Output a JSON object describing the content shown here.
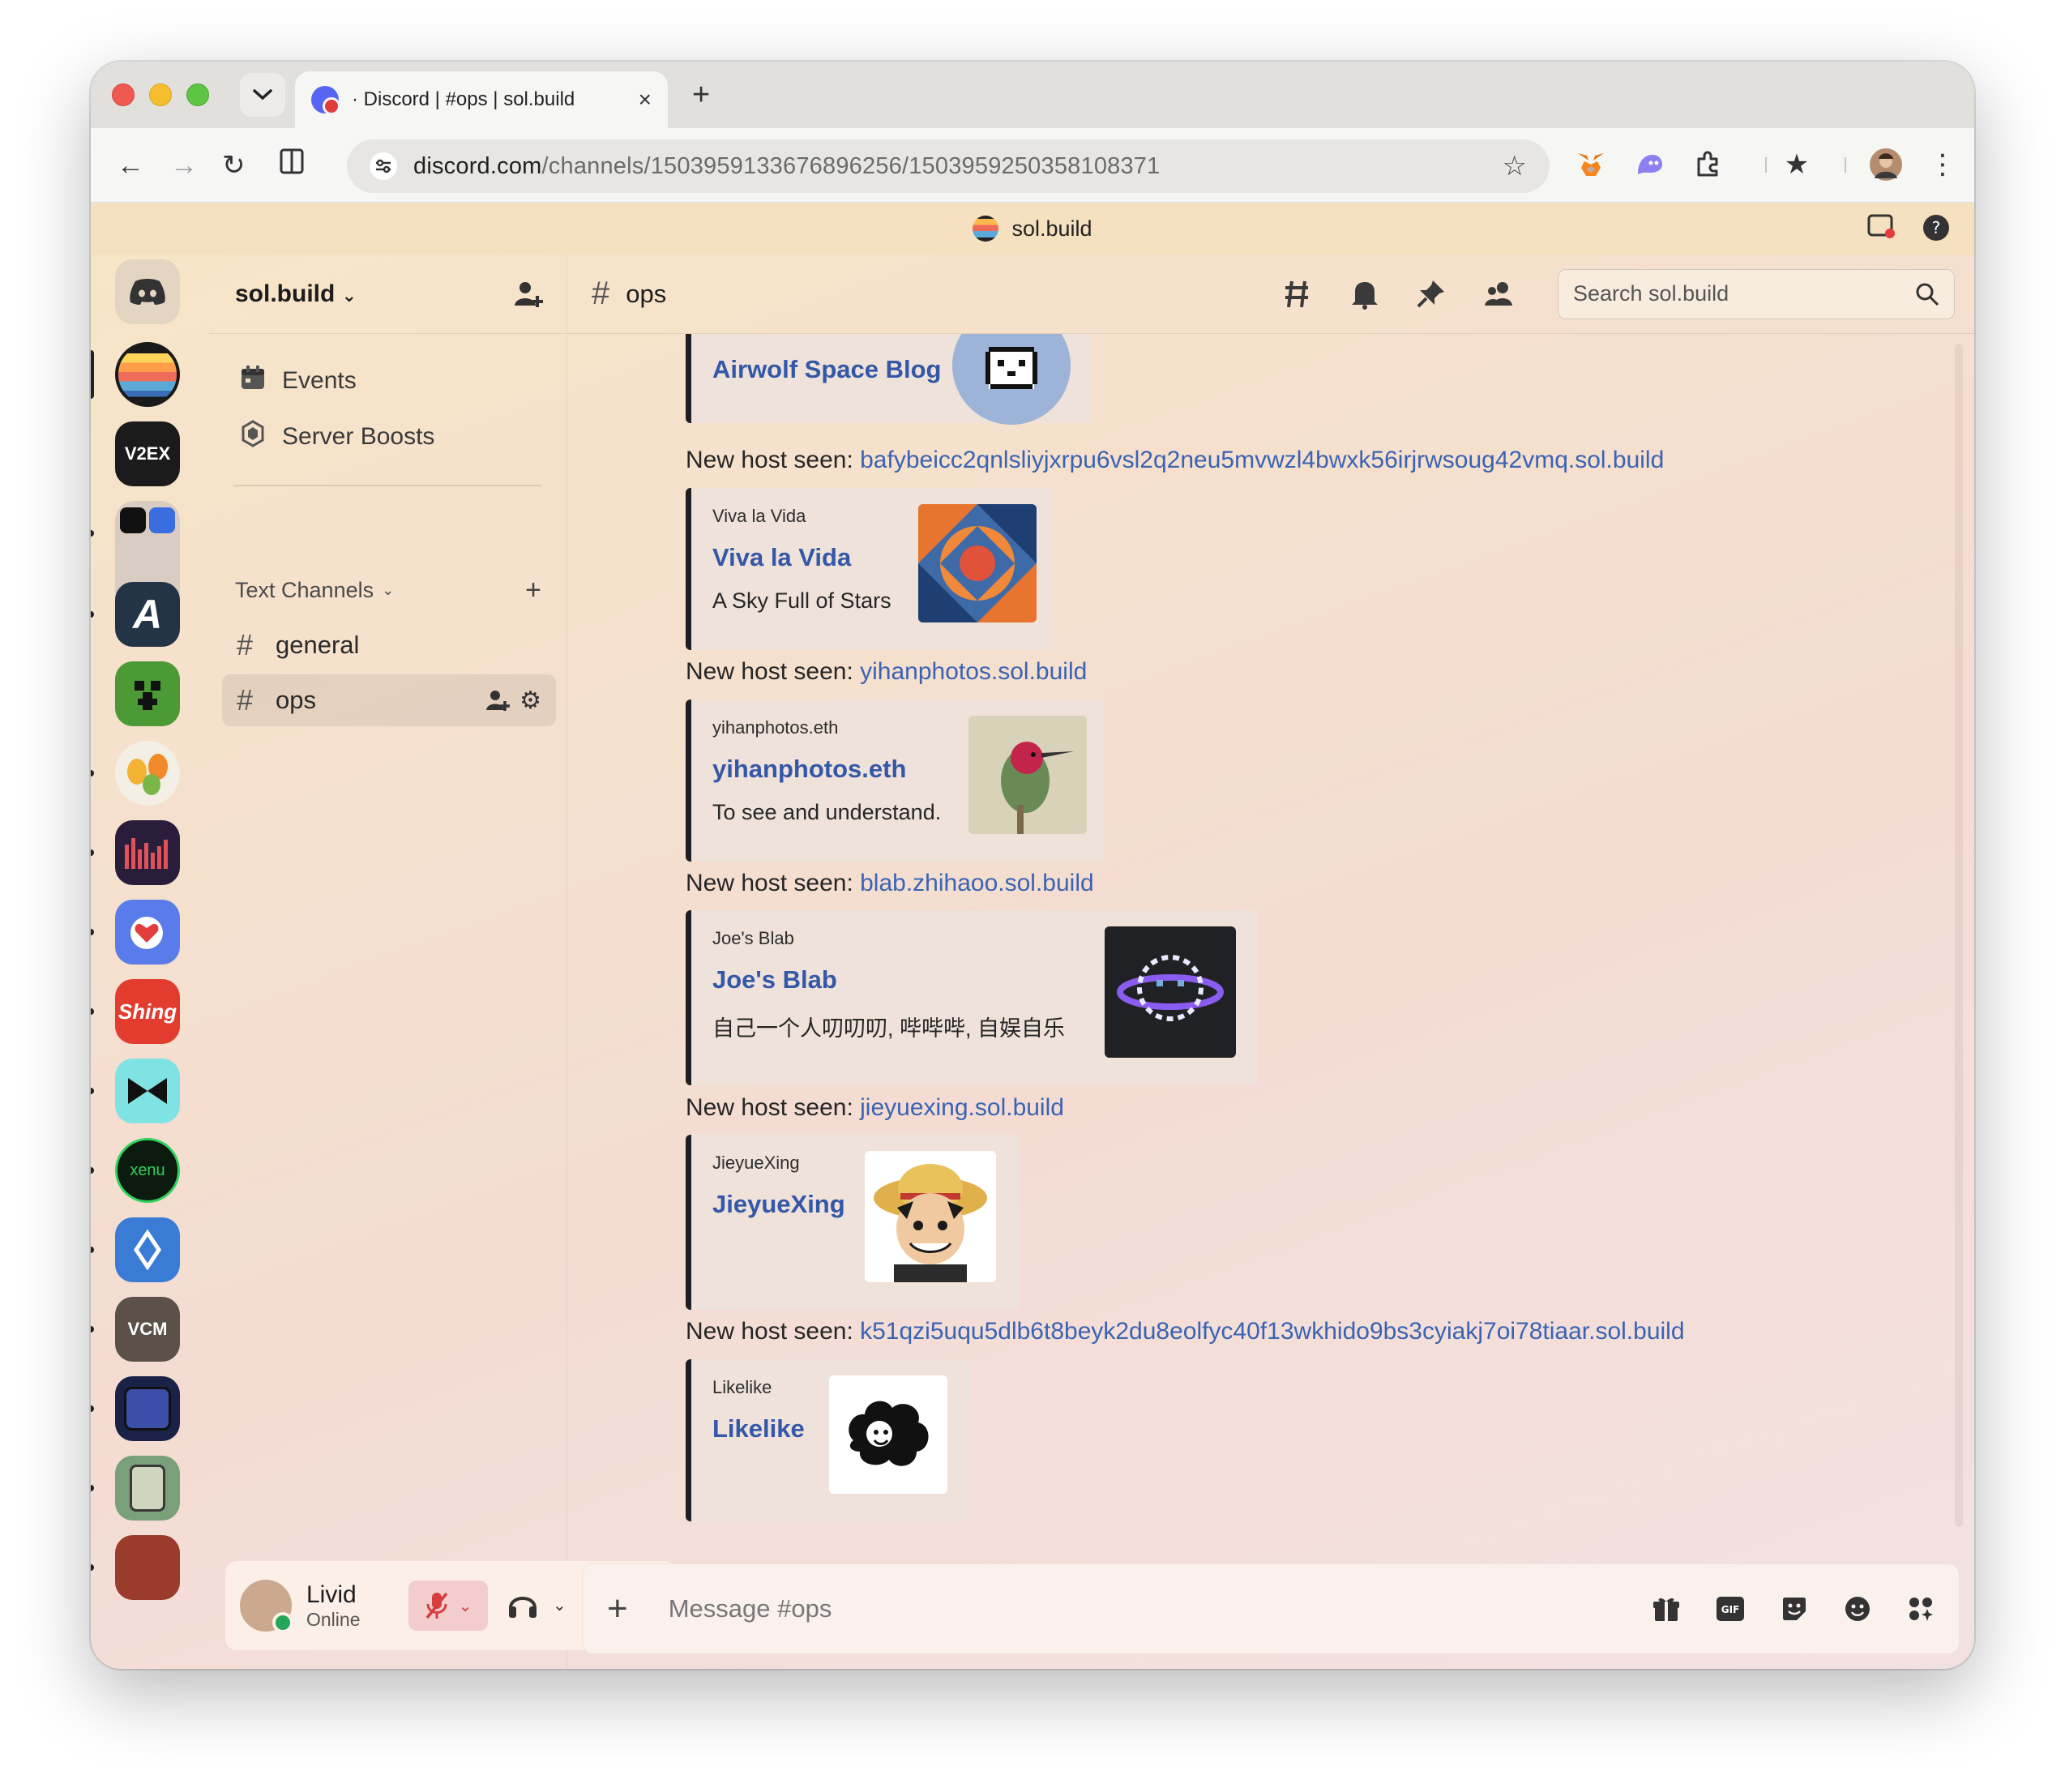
{
  "browser": {
    "tab_title": "· Discord | #ops | sol.build",
    "tab_close": "×",
    "new_tab": "+",
    "url_host": "discord.com",
    "url_path": "/channels/1503959133676896256/1503959250358108371",
    "banner_title": "sol.build"
  },
  "server": {
    "name": "sol.build",
    "nav": [
      {
        "label": "Events",
        "icon": "calendar-icon"
      },
      {
        "label": "Server Boosts",
        "icon": "boost-icon"
      }
    ],
    "category": "Text Channels",
    "channels": [
      {
        "name": "general",
        "selected": false
      },
      {
        "name": "ops",
        "selected": true
      }
    ]
  },
  "server_list": [
    {
      "name": "discord-home",
      "label": "",
      "color": "#e4d4c2"
    },
    {
      "name": "sol-build",
      "label": "",
      "color": "#222222"
    },
    {
      "name": "v2ex",
      "label": "V2EX",
      "color": "#1b1b1b"
    },
    {
      "name": "folder",
      "label": "",
      "color": "#d9cdc3"
    },
    {
      "name": "a-server",
      "label": "A",
      "color": "#243447"
    },
    {
      "name": "minecraft",
      "label": "",
      "color": "#4c9a35"
    },
    {
      "name": "birds",
      "label": "",
      "color": "#f3efe4"
    },
    {
      "name": "music",
      "label": "",
      "color": "#2a1d3c"
    },
    {
      "name": "heart-app",
      "label": "",
      "color": "#5a7bea"
    },
    {
      "name": "shing",
      "label": "Shing",
      "color": "#e23c2f"
    },
    {
      "name": "bowtie",
      "label": "",
      "color": "#7fe3e3"
    },
    {
      "name": "xenu",
      "label": "xenu",
      "color": "#0d1a10"
    },
    {
      "name": "ens",
      "label": "",
      "color": "#3a7bd5"
    },
    {
      "name": "vcm",
      "label": "VCM",
      "color": "#5b5148"
    },
    {
      "name": "ghost",
      "label": "",
      "color": "#1b2247"
    },
    {
      "name": "gameboy",
      "label": "",
      "color": "#7aa07a"
    },
    {
      "name": "skull",
      "label": "",
      "color": "#9a3b2c"
    }
  ],
  "user": {
    "name": "Livid",
    "status": "Online"
  },
  "channel": {
    "name": "ops",
    "search_placeholder": "Search sol.build",
    "composer_placeholder": "Message #ops"
  },
  "messages": [
    {
      "type": "embed",
      "provider": "",
      "title": "Airwolf Space Blog",
      "desc": ""
    },
    {
      "type": "text",
      "prefix": "New host seen: ",
      "link": "bafybeicc2qnlsliyjxrpu6vsl2q2neu5mvwzl4bwxk56irjrwsoug42vmq.sol.build"
    },
    {
      "type": "embed",
      "provider": "Viva la Vida",
      "title": "Viva la Vida",
      "desc": "A Sky Full of Stars"
    },
    {
      "type": "text",
      "prefix": "New host seen: ",
      "link": "yihanphotos.sol.build"
    },
    {
      "type": "embed",
      "provider": "yihanphotos.eth",
      "title": "yihanphotos.eth",
      "desc": "To see and understand."
    },
    {
      "type": "text",
      "prefix": "New host seen: ",
      "link": "blab.zhihaoo.sol.build"
    },
    {
      "type": "embed",
      "provider": "Joe's Blab",
      "title": "Joe's Blab",
      "desc": "自己一个人叨叨叨, 哔哔哔, 自娱自乐"
    },
    {
      "type": "text",
      "prefix": "New host seen: ",
      "link": "jieyuexing.sol.build"
    },
    {
      "type": "embed",
      "provider": "JieyueXing",
      "title": "JieyueXing",
      "desc": ""
    },
    {
      "type": "text",
      "prefix": "New host seen: ",
      "link": "k51qzi5uqu5dlb6t8beyk2du8eolfyc40f13wkhido9bs3cyiakj7oi78tiaar.sol.build"
    },
    {
      "type": "embed",
      "provider": "Likelike",
      "title": "Likelike",
      "desc": ""
    }
  ],
  "colors": {
    "link": "#3a63b3",
    "embed_title": "#3457a8",
    "online": "#23a55a",
    "mic_muted": "#d83c3e"
  }
}
